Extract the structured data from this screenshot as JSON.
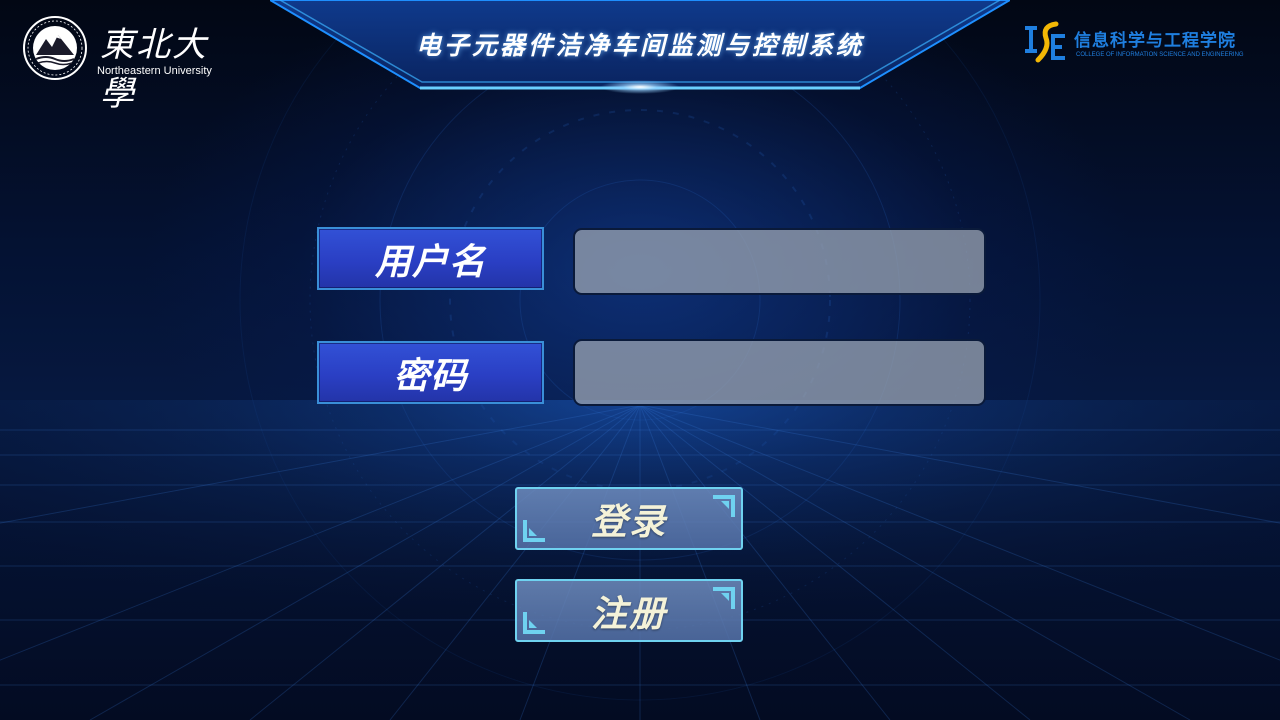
{
  "header": {
    "title": "电子元器件洁净车间监测与控制系统",
    "university": {
      "name_cn": "東北大學",
      "name_en": "Northeastern University"
    },
    "college": {
      "name_cn": "信息科学与工程学院",
      "name_en": "COLLEGE OF INFORMATION SCIENCE AND ENGINEERING"
    }
  },
  "form": {
    "username_label": "用户名",
    "username_value": "",
    "password_label": "密码",
    "password_value": ""
  },
  "actions": {
    "login_label": "登录",
    "register_label": "注册"
  },
  "colors": {
    "accent": "#2ea6ff",
    "label_bg": "#2a3fc4",
    "button_border": "#6fd2f0",
    "college_brand": "#1f7fe0"
  }
}
